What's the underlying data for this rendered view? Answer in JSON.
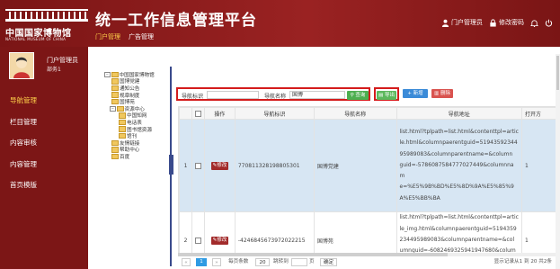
{
  "header": {
    "logo_cn": "中国国家博物馆",
    "logo_en": "NATIONAL MUSEUM OF CHINA",
    "title": "统一工作信息管理平台",
    "tabs": [
      {
        "label": "门户管理",
        "active": true
      },
      {
        "label": "广告管理",
        "active": false
      }
    ],
    "user_label": "门户管理员",
    "change_password": "修改密码"
  },
  "sidebar": {
    "user_name": "门户管理员",
    "user_dept": "部务1",
    "menu": [
      {
        "label": "导航管理",
        "active": true
      },
      {
        "label": "栏目管理",
        "active": false
      },
      {
        "label": "内容审核",
        "active": false
      },
      {
        "label": "内容管理",
        "active": false
      },
      {
        "label": "首页模版",
        "active": false
      }
    ]
  },
  "tree": [
    "中国国家博物馆",
    "国博党建",
    "通知公告",
    "规章制度",
    "国博苑",
    "资源中心",
    "中国知网",
    "电话表",
    "图书馆资源",
    "馆刊",
    "友情链接",
    "帮助中心",
    "百度"
  ],
  "toolbar": {
    "nav_id_label": "导航标识",
    "nav_id_value": "",
    "nav_name_label": "导航名称",
    "nav_name_value": "国博",
    "query_label": "查询",
    "export_label": "导出",
    "add_label": "新增",
    "delete_label": "删除"
  },
  "table": {
    "columns": [
      "",
      "",
      "操作",
      "导航标识",
      "导航名称",
      "导航地址",
      "打开方"
    ],
    "edit_label": "修改",
    "rows": [
      {
        "index": "1",
        "nav_id": "770811328198805301",
        "nav_name": "国博党建",
        "address_lines": [
          "list.html?tplpath=list.html&contenttpl=artic",
          "le.html&columnpaerentguid=51943592344",
          "95989083&columnparentname=&column",
          "guid=-5786087584777027449&columnnam",
          "e=%E5%9B%BD%E5%8D%9A%E5%85%9",
          "A%E5%BB%BA"
        ],
        "open_mode": "1"
      },
      {
        "index": "2",
        "nav_id": "-4246845673972022215",
        "nav_name": "国博苑",
        "address_lines": [
          "list.html?tplpath=list.html&contenttpl=artic",
          "le_img.html&columnpaerentguid=5194359",
          "234495989083&columnparentname=&col",
          "umnguid=-6082469325941947680&column"
        ],
        "open_mode": "1"
      }
    ]
  },
  "pager": {
    "first": "«",
    "current": "1",
    "next": "»",
    "per_page_label": "每页条数",
    "per_page_value": "20",
    "jump_label": "跳转到",
    "jump_value": "",
    "page_unit": "页",
    "confirm_label": "确定",
    "summary": "显示记录从1 到 20 共2条"
  },
  "colors": {
    "header_bg": "#8c1b1b",
    "sidebar_bg": "#7c1616",
    "active_text": "#ffd24a",
    "highlight_border": "#d41c1c",
    "selected_row": "#d7e6f3",
    "edit_button": "#a22b2b"
  },
  "icons": [
    "user-icon",
    "lock-icon",
    "bell-icon",
    "power-icon",
    "search-icon",
    "export-icon",
    "plus-icon",
    "trash-icon",
    "edit-icon",
    "folder-icon"
  ]
}
